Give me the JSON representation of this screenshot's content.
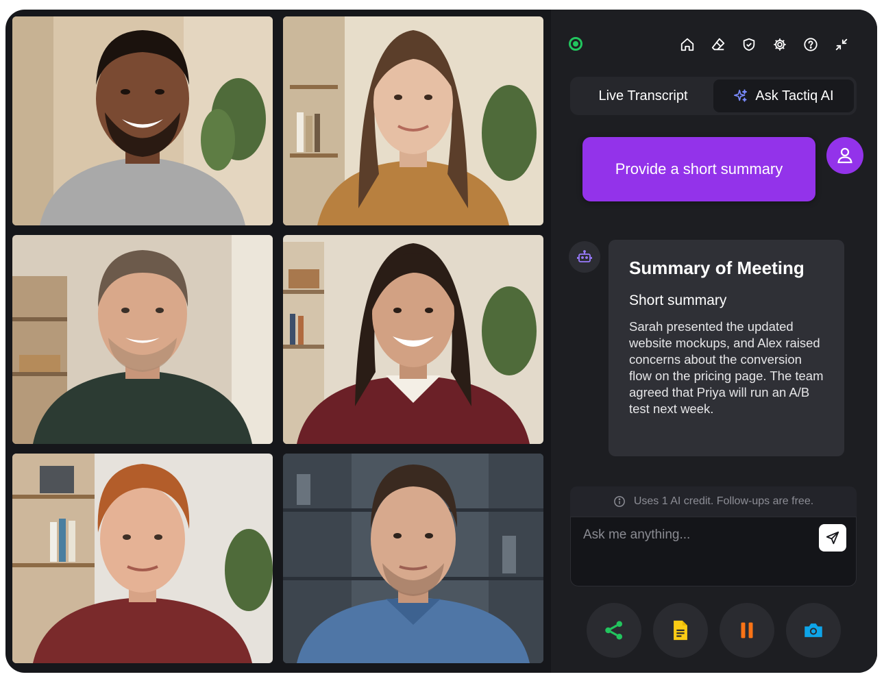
{
  "panel": {
    "status": "recording",
    "toolbar_icons": [
      "home-icon",
      "eraser-icon",
      "shield-icon",
      "gear-icon",
      "help-icon",
      "collapse-icon"
    ],
    "tabs": [
      {
        "label": "Live Transcript",
        "active": false
      },
      {
        "label": "Ask Tactiq AI",
        "active": true,
        "icon": "sparkle-icon"
      }
    ],
    "user_message": "Provide a short summary",
    "bot_message": {
      "title": "Summary of Meeting",
      "subtitle": "Short summary",
      "body": "Sarah presented the updated website mockups, and Alex raised concerns about the conversion flow on the pricing page. The team agreed that Priya will run an A/B test next week."
    },
    "credit_note": "Uses 1 AI credit. Follow-ups are free.",
    "input": {
      "placeholder": "Ask me anything...",
      "value": ""
    },
    "actions": [
      {
        "name": "share",
        "icon": "share-icon",
        "color": "#22c55e"
      },
      {
        "name": "notes",
        "icon": "document-icon",
        "color": "#facc15"
      },
      {
        "name": "pause",
        "icon": "pause-icon",
        "color": "#f97316"
      },
      {
        "name": "screenshot",
        "icon": "camera-icon",
        "color": "#0ea5e9"
      }
    ],
    "colors": {
      "accent": "#9333ea",
      "status": "#22c55e",
      "panel_bg": "#1d1e22"
    }
  },
  "participants": [
    {
      "tile": 1,
      "skin": "#7a4a32",
      "hair": "#1b120d",
      "shirt": "#a9a9a9",
      "bg": "#d9c6aa"
    },
    {
      "tile": 2,
      "skin": "#e6bfa4",
      "hair": "#5b3e2a",
      "shirt": "#b8803f",
      "bg": "#e7ddca"
    },
    {
      "tile": 3,
      "skin": "#d9a88a",
      "hair": "#6c5a4b",
      "shirt": "#2c3b33",
      "bg": "#d8cdbd"
    },
    {
      "tile": 4,
      "skin": "#d2a183",
      "hair": "#2a1d16",
      "shirt": "#6b2027",
      "bg": "#e3dacb"
    },
    {
      "tile": 5,
      "skin": "#e5b295",
      "hair": "#b35d2a",
      "shirt": "#7a2a2b",
      "bg": "#e6e2dc"
    },
    {
      "tile": 6,
      "skin": "#d7a98d",
      "hair": "#3a2a20",
      "shirt": "#4f76a6",
      "bg": "#4c5660"
    }
  ]
}
